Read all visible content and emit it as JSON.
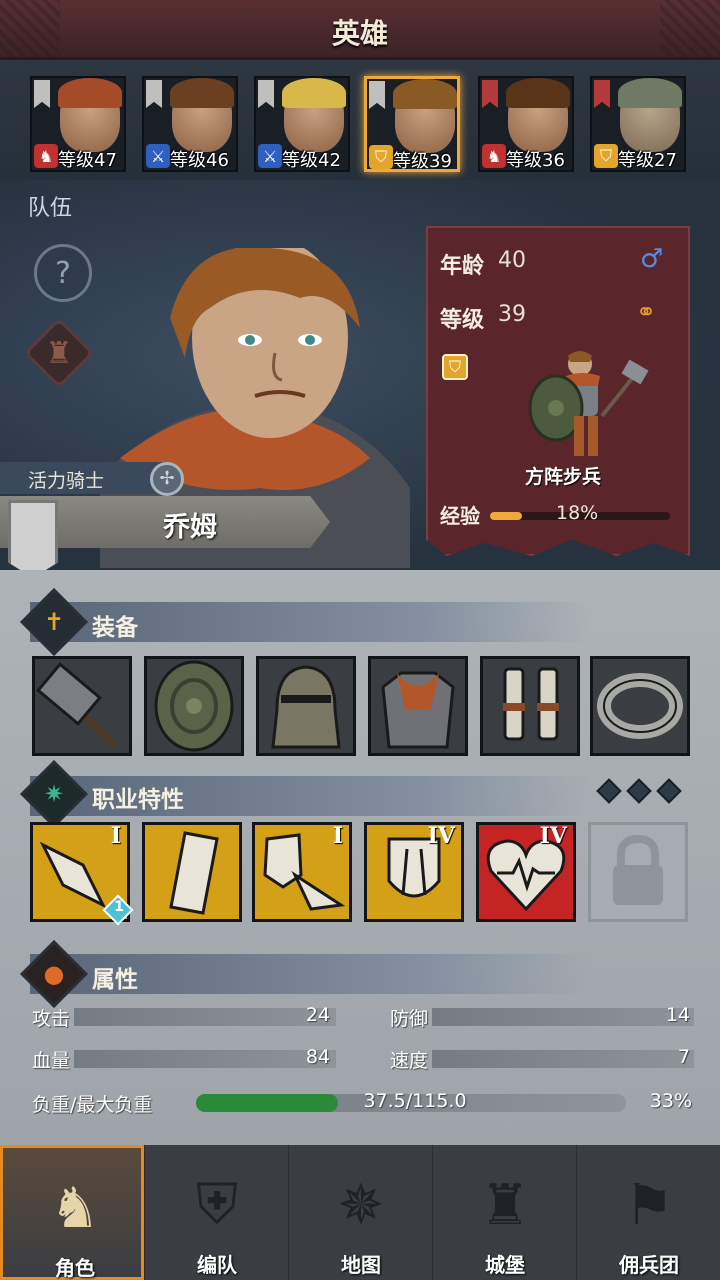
{
  "header": {
    "title": "英雄"
  },
  "heroes": [
    {
      "level_label": "等级47",
      "type_icon": "horse-icon",
      "badge_color": "#c23030",
      "hair_color": "#a64b2a"
    },
    {
      "level_label": "等级46",
      "type_icon": "sword-icon",
      "badge_color": "#2f5fbf",
      "hair_color": "#6b4020"
    },
    {
      "level_label": "等级42",
      "type_icon": "sword-icon",
      "badge_color": "#2f5fbf",
      "hair_color": "#d9b84a"
    },
    {
      "level_label": "等级39",
      "type_icon": "shield-icon",
      "badge_color": "#e3a52a",
      "hair_color": "#8a5a24",
      "selected": true
    },
    {
      "level_label": "等级36",
      "type_icon": "horse-icon",
      "badge_color": "#c23030",
      "hair_color": "#5a3418"
    },
    {
      "level_label": "等级27",
      "type_icon": "shield-icon",
      "badge_color": "#e3a52a",
      "hair_color": "#6d7a64"
    }
  ],
  "team": {
    "label": "队伍"
  },
  "info": {
    "age_label": "年龄",
    "age_value": "40",
    "level_label": "等级",
    "level_value": "39",
    "class_name": "方阵步兵",
    "xp_label": "经验",
    "xp_value": "18%",
    "xp_fraction": 0.18
  },
  "hero": {
    "title": "活力骑士",
    "name": "乔姆"
  },
  "sections": {
    "equipment": "装备",
    "traits": "职业特性",
    "attributes": "属性"
  },
  "equipment": [
    {
      "icon": "warhammer-icon"
    },
    {
      "icon": "round-shield-icon"
    },
    {
      "icon": "helmet-icon"
    },
    {
      "icon": "chainmail-armor-icon"
    },
    {
      "icon": "greaves-icon"
    },
    {
      "icon": "ring-icon"
    }
  ],
  "traits": [
    {
      "icon": "shield-bash-icon",
      "rank": "I",
      "bg": "#d4a017",
      "badge": "1"
    },
    {
      "icon": "shield-wall-icon",
      "rank": "",
      "bg": "#d4a017"
    },
    {
      "icon": "shield-strike-icon",
      "rank": "I",
      "bg": "#d4a017"
    },
    {
      "icon": "fortify-shield-icon",
      "rank": "IV",
      "bg": "#d4a017"
    },
    {
      "icon": "heart-vitality-icon",
      "rank": "IV",
      "bg": "#c42424"
    },
    {
      "icon": "lock-icon",
      "rank": "",
      "bg": "#9aa0a6",
      "locked": true
    }
  ],
  "stats": {
    "attack_label": "攻击",
    "attack_value": "24",
    "defense_label": "防御",
    "defense_value": "14",
    "hp_label": "血量",
    "hp_value": "84",
    "speed_label": "速度",
    "speed_value": "7",
    "load_label": "负重/最大负重",
    "load_value": "37.5/115.0",
    "load_pct": "33%",
    "load_fraction": 0.33
  },
  "nav": [
    {
      "label": "角色",
      "icon": "knight-icon",
      "active": true
    },
    {
      "label": "编队",
      "icon": "helmet-squad-icon"
    },
    {
      "label": "地图",
      "icon": "compass-icon"
    },
    {
      "label": "城堡",
      "icon": "castle-icon"
    },
    {
      "label": "佣兵团",
      "icon": "mercenary-flag-icon"
    }
  ]
}
